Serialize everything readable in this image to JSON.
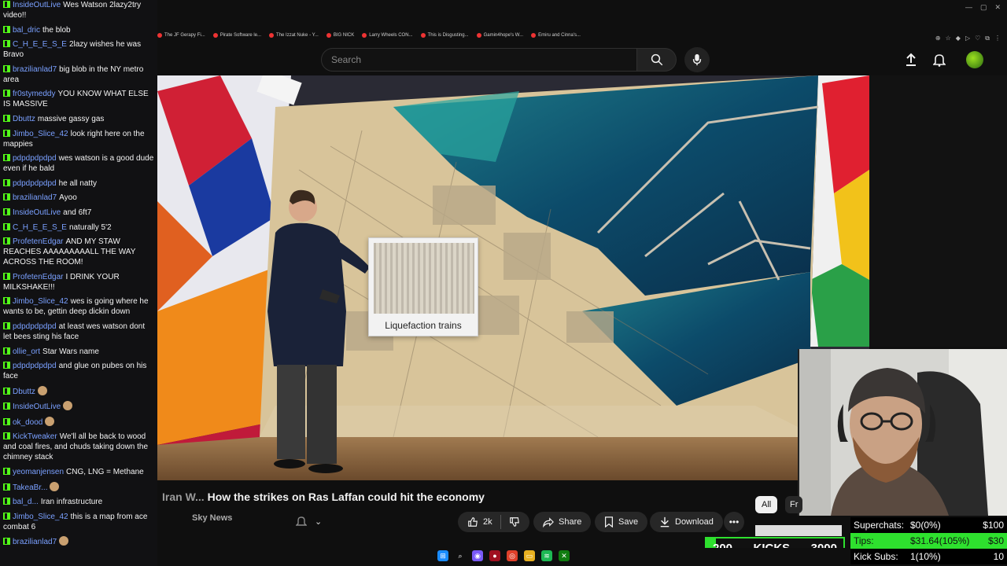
{
  "browser": {
    "bookmarks": [
      "The JF Gerapy Fi...",
      "Pirate Software le...",
      "The Izzat Nuke - Y...",
      "BIG NICK",
      "Larry Wheels CON...",
      "This is Disgusting...",
      "Gamin4hope's W...",
      "Emiru and Cinna's..."
    ]
  },
  "youtube": {
    "search_placeholder": "Search",
    "video": {
      "title_prefix": "Iran W...",
      "title": "How the strikes on Ras Laffan could hit the economy",
      "overlay_caption": "Liquefaction trains",
      "channel": "Sky News",
      "likes": "2k",
      "share_label": "Share",
      "save_label": "Save",
      "download_label": "Download"
    },
    "chips": {
      "all": "All",
      "fr": "Fr"
    }
  },
  "stream": {
    "stats": {
      "superchats_label": "Superchats:",
      "superchats_value": "$0(0%)",
      "superchats_goal": "$100",
      "tips_label": "Tips:",
      "tips_value": "$31.64(105%)",
      "tips_goal": "$30",
      "kick_subs_label": "Kick Subs:",
      "kick_subs_value": "1(10%)",
      "kick_subs_goal": "10"
    },
    "kicks_bar": {
      "current": "200",
      "label": "KICKS",
      "goal": "3000",
      "progress_fraction": 0.067
    }
  },
  "chat": {
    "messages": [
      {
        "user": "InsideOutLive",
        "text": "Wes Watson 2lazy2try video!!"
      },
      {
        "user": "bal_dric",
        "text": "the blob"
      },
      {
        "user": "C_H_E_E_S_E",
        "text": "2lazy wishes he was Bravo"
      },
      {
        "user": "brazilianlad7",
        "text": "big blob in the NY metro area"
      },
      {
        "user": "fr0stymeddy",
        "text": "YOU KNOW WHAT ELSE IS MASSIVE"
      },
      {
        "user": "Dbuttz",
        "text": "massive gassy gas"
      },
      {
        "user": "Jimbo_Slice_42",
        "text": "look right here on the mappies"
      },
      {
        "user": "pdpdpdpdpd",
        "text": "wes watson is a good dude even if he bald"
      },
      {
        "user": "pdpdpdpdpd",
        "text": "he all natty"
      },
      {
        "user": "brazilianlad7",
        "text": "Ayoo"
      },
      {
        "user": "InsideOutLive",
        "text": "and 6ft7"
      },
      {
        "user": "C_H_E_E_S_E",
        "text": "naturally 5'2"
      },
      {
        "user": "ProfetenEdgar",
        "text": "AND MY STAW REACHES AAAAAAAAALL THE WAY ACROSS THE ROOM!"
      },
      {
        "user": "ProfetenEdgar",
        "text": "I DRINK YOUR MILKSHAKE!!!"
      },
      {
        "user": "Jimbo_Slice_42",
        "text": "wes is going where he wants to be, gettin deep dickin down"
      },
      {
        "user": "pdpdpdpdpd",
        "text": "at least wes watson dont let bees sting his face"
      },
      {
        "user": "ollie_ort",
        "text": "Star Wars name"
      },
      {
        "user": "pdpdpdpdpd",
        "text": "and glue on pubes on his face"
      },
      {
        "user": "Dbuttz",
        "text": ""
      },
      {
        "user": "InsideOutLive",
        "text": ""
      },
      {
        "user": "ok_dood",
        "text": ""
      },
      {
        "user": "KickTweaker",
        "text": "We'll all be back to wood and coal fires, and chuds taking down the chimney stack"
      },
      {
        "user": "yeomanjensen",
        "text": "CNG, LNG = Methane"
      },
      {
        "user": "TakeaBr...",
        "text": ""
      },
      {
        "user": "bal_d...",
        "text": "Iran infrastructure"
      },
      {
        "user": "Jimbo_Slice_42",
        "text": "this is a map from ace combat 6"
      },
      {
        "user": "brazilianlad7",
        "text": ""
      }
    ]
  },
  "colors": {
    "kick_green": "#53fc18",
    "tips_green": "#2ee02e",
    "yt_bg": "#0f0f0f",
    "chat_user": "#7aa0ff"
  }
}
